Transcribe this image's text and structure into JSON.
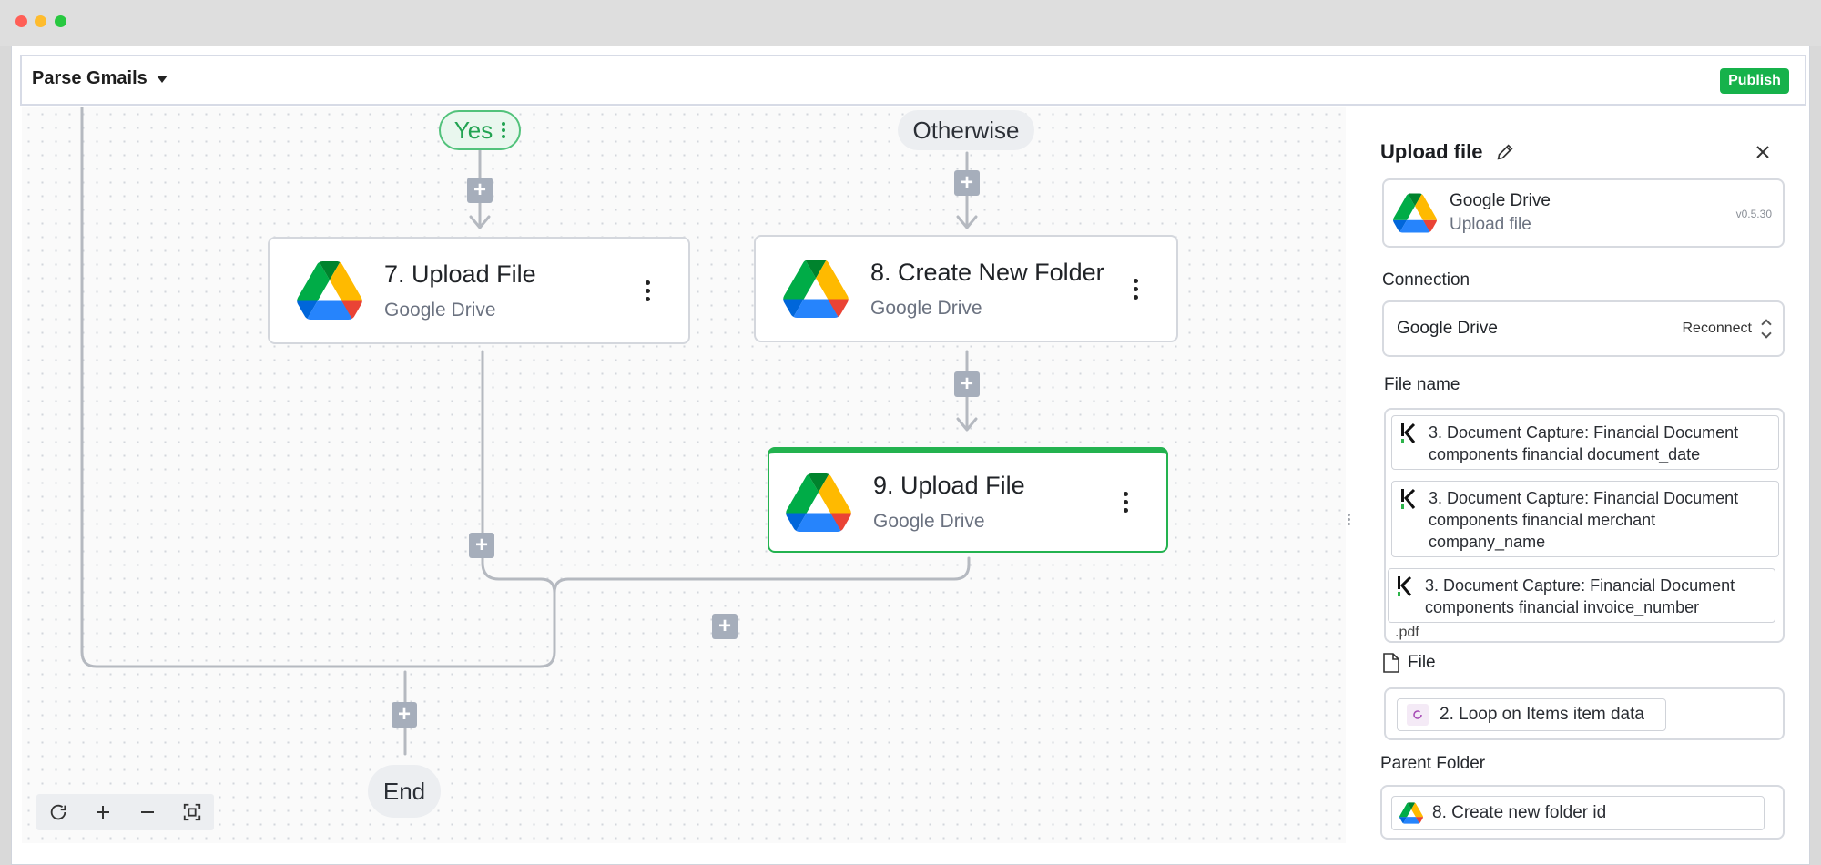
{
  "header": {
    "flow_title": "Parse Gmails",
    "publish_label": "Publish"
  },
  "canvas": {
    "branch_yes": "Yes",
    "branch_otherwise": "Otherwise",
    "end_label": "End",
    "steps": [
      {
        "title": "7. Upload File",
        "subtitle": "Google Drive"
      },
      {
        "title": "8. Create New Folder",
        "subtitle": "Google Drive"
      },
      {
        "title": "9. Upload File",
        "subtitle": "Google Drive"
      }
    ],
    "add_symbol": "+",
    "zoom_controls": [
      "refresh-icon",
      "zoom-in-icon",
      "zoom-out-icon",
      "fit-view-icon"
    ]
  },
  "panel": {
    "title": "Upload file",
    "piece_name": "Google Drive",
    "piece_action": "Upload file",
    "piece_version": "v0.5.30",
    "connection_label": "Connection",
    "connection_value": "Google Drive",
    "reconnect_label": "Reconnect",
    "file_name_label": "File name",
    "file_name_chips": [
      "3. Document Capture: Financial Document components financial document_date",
      "3. Document Capture: Financial Document components financial merchant company_name",
      "3. Document Capture: Financial Document components financial invoice_number"
    ],
    "file_name_separator": "_",
    "file_name_suffix": ".pdf",
    "file_label": "File",
    "file_value": "2. Loop on Items item data",
    "parent_folder_label": "Parent Folder",
    "parent_folder_value": "8. Create new folder id"
  },
  "colors": {
    "accent": "#16b24b",
    "active_border": "#23b24f",
    "wire": "#b5b9c0",
    "add_button": "#a6aebb"
  }
}
